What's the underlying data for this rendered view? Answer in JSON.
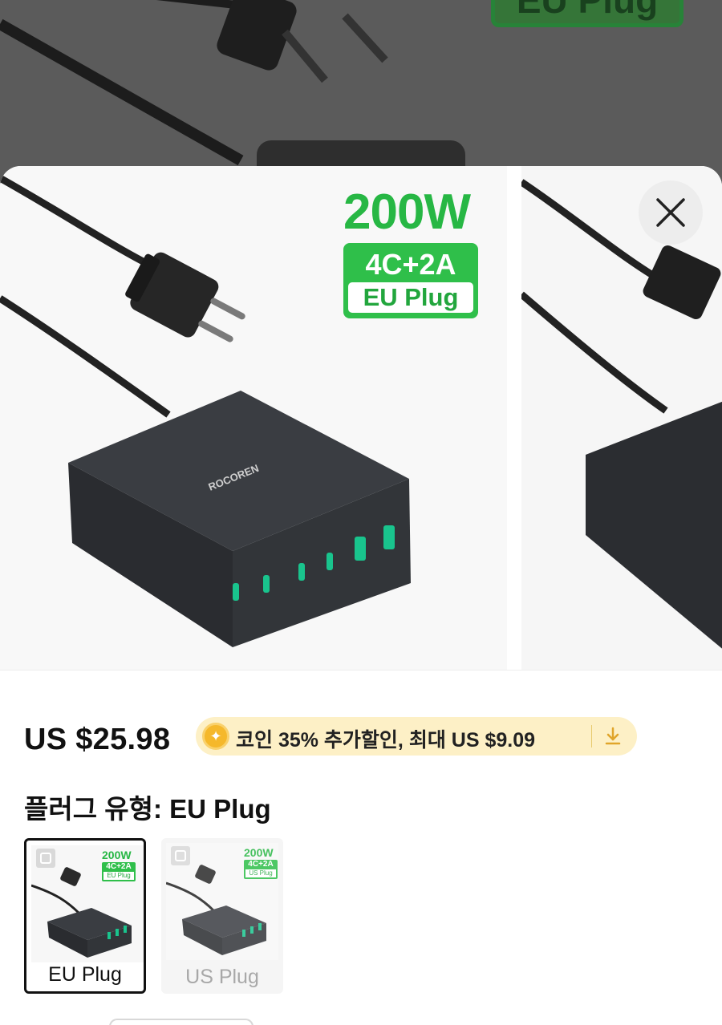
{
  "backdrop": {
    "badge_text": "EU Plug"
  },
  "product_image": {
    "wattage": "200W",
    "ports": "4C+2A",
    "plug": "EU Plug",
    "brand": "ROCOREN"
  },
  "close_icon": "close-icon",
  "price": {
    "amount": "US $25.98",
    "coin_offer": "코인 35% 추가할인, 최대 US $9.09",
    "coin_icon": "coin-icon",
    "download_icon": "download-icon",
    "pill_color": "#fdf0c6"
  },
  "plug_type": {
    "label": "플러그 유형: EU Plug",
    "options": [
      {
        "name": "EU Plug",
        "selected": true,
        "wattage": "200W",
        "ports": "4C+2A",
        "plug": "EU Plug"
      },
      {
        "name": "US Plug",
        "selected": false,
        "wattage": "200W",
        "ports": "4C+2A",
        "plug": "US Plug"
      }
    ]
  },
  "colors": {
    "accent_green": "#2fbf4a",
    "text": "#111111"
  }
}
